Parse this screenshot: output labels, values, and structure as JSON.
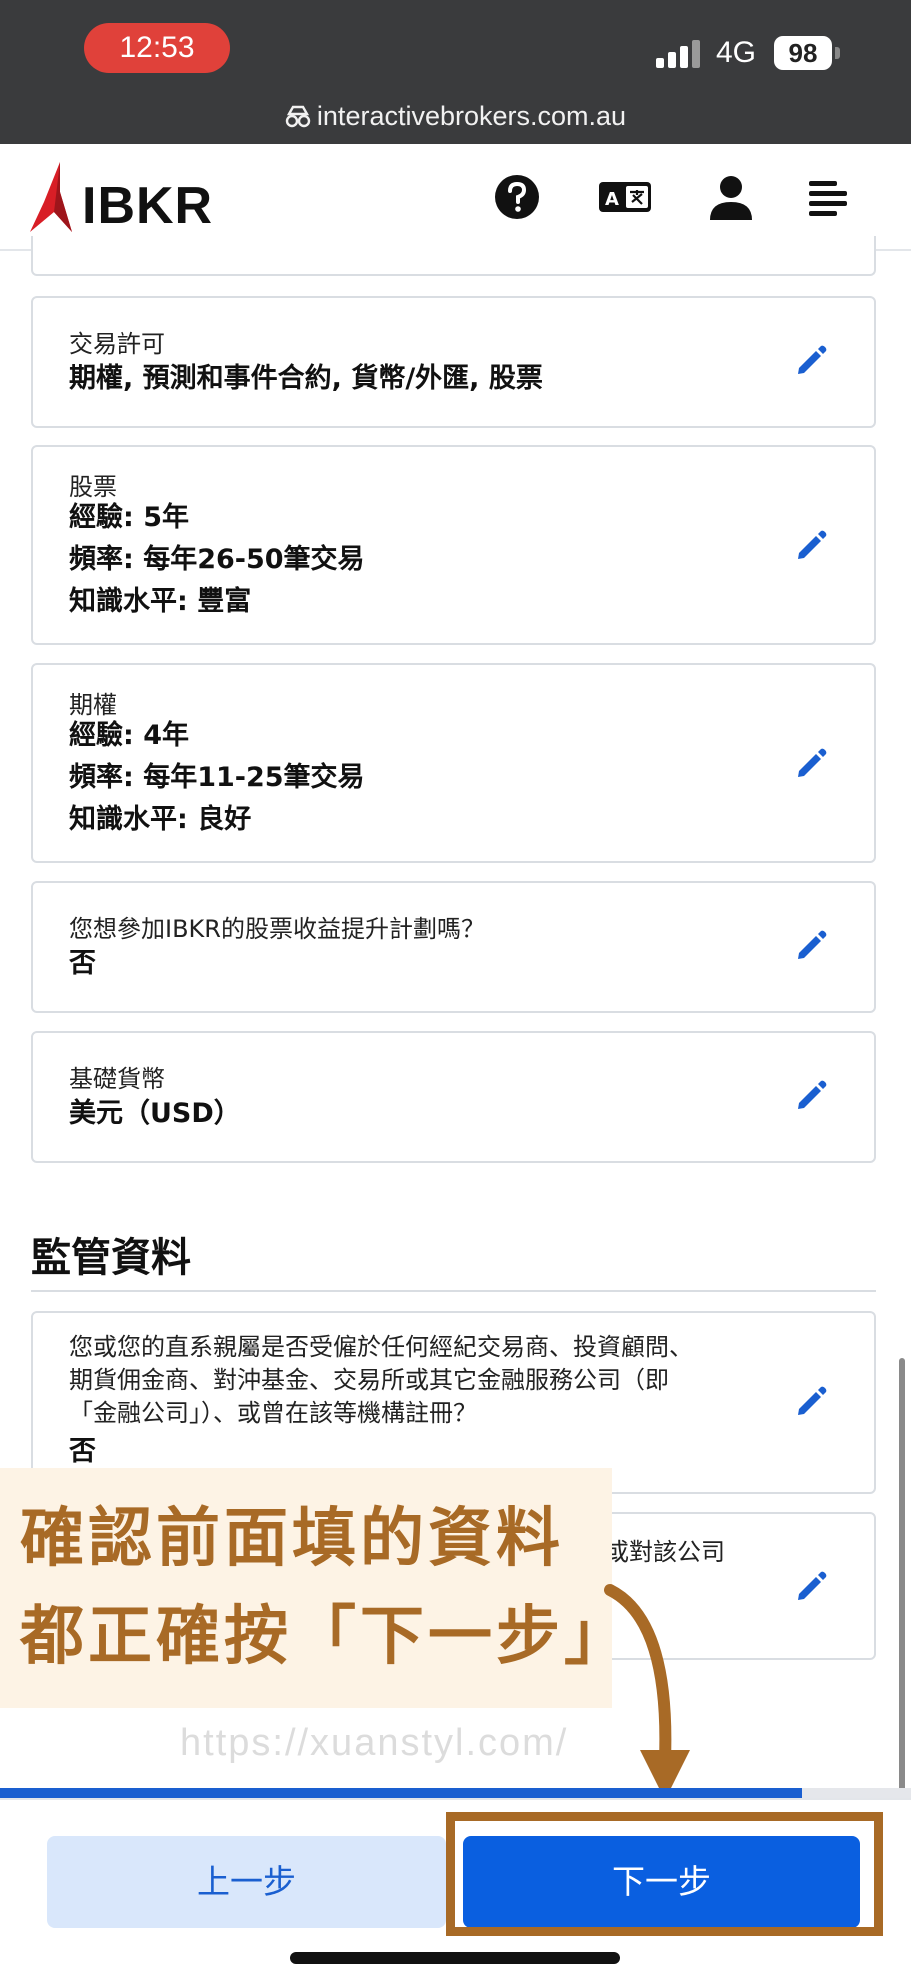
{
  "status_bar": {
    "time": "12:53",
    "network": "4G",
    "battery": "98"
  },
  "browser": {
    "url": "interactivebrokers.com.au"
  },
  "header": {
    "logo_text": "IBKR",
    "icons": [
      "help-icon",
      "translate-icon",
      "user-icon",
      "menu-icon"
    ]
  },
  "cards": [
    {
      "label": "交易許可",
      "values": [
        "期權, 預測和事件合約, 貨幣/外匯, 股票"
      ]
    },
    {
      "label": "股票",
      "values": [
        "經驗: 5年",
        "頻率: 每年26-50筆交易",
        "知識水平: 豐富"
      ]
    },
    {
      "label": "期權",
      "values": [
        "經驗: 4年",
        "頻率: 每年11-25筆交易",
        "知識水平: 良好"
      ]
    },
    {
      "label": "您想參加IBKR的股票收益提升計劃嗎？",
      "values": [
        "否"
      ]
    },
    {
      "label": "基礎貨幣",
      "values": [
        "美元（USD）"
      ]
    }
  ],
  "regulatory": {
    "title": "監管資料",
    "card1": {
      "lines": [
        "您或您的直系親屬是否受僱於任何經紀交易商、投資顧問、",
        "期貨佣金商、對沖基金、交易所或其它金融服務公司（即",
        "「金融公司」）、或曾在該等機構註冊？"
      ],
      "value": "否"
    },
    "card2": {
      "partial_label": "或對該公司"
    }
  },
  "annotation": {
    "line1": "確認前面填的資料",
    "line2": "都正確按「下一步」"
  },
  "watermark": "https://xuanstyl.com/",
  "progress_percent": 88,
  "footer": {
    "back_label": "上一步",
    "next_label": "下一步"
  },
  "colors": {
    "accent": "#0a5fe0",
    "annotation": "#a86a26",
    "time_pill": "#e0413a"
  }
}
